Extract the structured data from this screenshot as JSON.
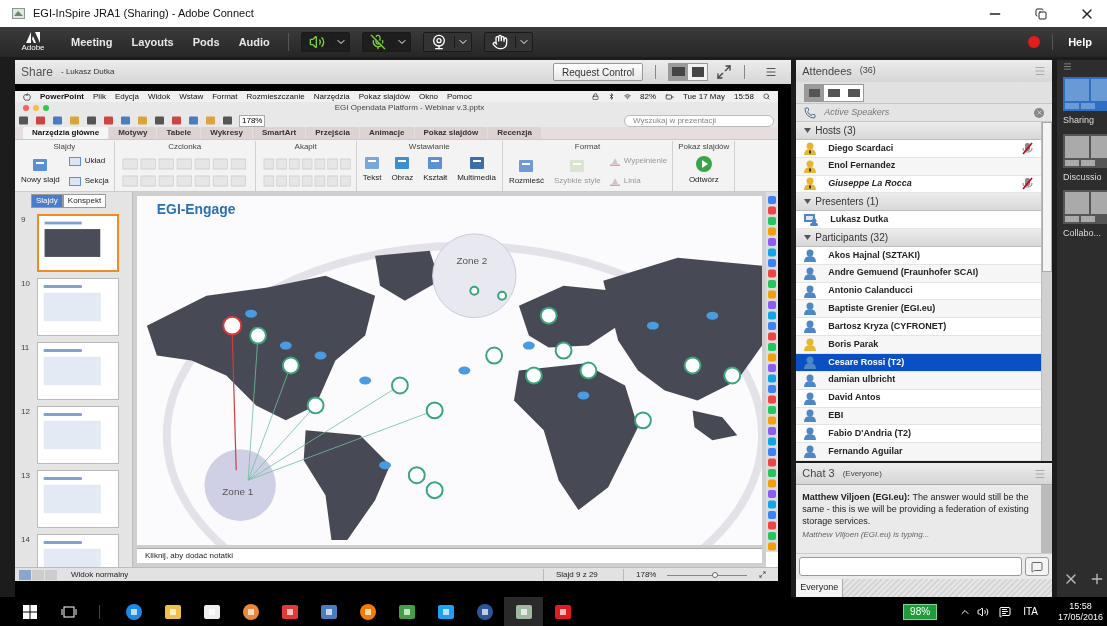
{
  "window": {
    "title": "EGI-InSpire JRA1 (Sharing) - Adobe Connect"
  },
  "menubar": {
    "logo_text": "Adobe",
    "items": [
      "Meeting",
      "Layouts",
      "Pods",
      "Audio"
    ],
    "help": "Help"
  },
  "share_pod": {
    "title": "Share",
    "presenter": "- Lukasz Dutka",
    "request_button": "Request Control"
  },
  "shared_screen": {
    "mac_menu": [
      "PowerPoint",
      "Plik",
      "Edycja",
      "Widok",
      "Wstaw",
      "Format",
      "Rozmieszczanie",
      "Narzędzia",
      "Pokaz slajdów",
      "Okno",
      "Pomoc"
    ],
    "mac_status": {
      "battery": "82%",
      "date": "Tue 17 May",
      "time": "15:58"
    },
    "doc_title": "EGI Opendata Platform - Webinar v.3.pptx",
    "zoom": "178%",
    "search_placeholder": "Wyszukaj w prezentacji",
    "tabs": [
      {
        "label": "Narzędzia główne",
        "selected": true
      },
      {
        "label": "Motywy",
        "selected": false
      },
      {
        "label": "Tabele",
        "selected": false
      },
      {
        "label": "Wykresy",
        "selected": false
      },
      {
        "label": "SmartArt",
        "selected": false
      },
      {
        "label": "Przejścia",
        "selected": false
      },
      {
        "label": "Animacje",
        "selected": false
      },
      {
        "label": "Pokaz slajdów",
        "selected": false
      },
      {
        "label": "Recenzja",
        "selected": false
      }
    ],
    "ribbon_groups": [
      {
        "title": "Slajdy",
        "kind": "slides",
        "buttons": [
          {
            "label": "Nowy slajd",
            "disabled": false
          },
          {
            "label": "Układ",
            "disabled": false
          },
          {
            "label": "Sekcja",
            "disabled": false
          }
        ]
      },
      {
        "title": "Czcionka",
        "kind": "font"
      },
      {
        "title": "Akapit",
        "kind": "paragraph"
      },
      {
        "title": "Wstawianie",
        "kind": "insert",
        "buttons": [
          {
            "label": "Tekst",
            "disabled": false
          },
          {
            "label": "Obraz",
            "disabled": false
          },
          {
            "label": "Kształt",
            "disabled": false
          },
          {
            "label": "Multimedia",
            "disabled": false
          }
        ]
      },
      {
        "title": "Format",
        "kind": "format",
        "buttons": [
          {
            "label": "Rozmieść",
            "disabled": false
          },
          {
            "label": "Szybkie style",
            "disabled": true
          },
          {
            "label": "Wypełnienie",
            "disabled": true
          },
          {
            "label": "Linia",
            "disabled": true
          }
        ]
      },
      {
        "title": "Pokaz slajdów",
        "kind": "show",
        "buttons": [
          {
            "label": "Odtwórz",
            "disabled": false
          }
        ]
      }
    ],
    "panel_tabs": [
      {
        "label": "Slajdy",
        "selected": true
      },
      {
        "label": "Konspekt",
        "selected": false
      }
    ],
    "thumbnails": [
      {
        "number": "9",
        "selected": true
      },
      {
        "number": "10",
        "selected": false
      },
      {
        "number": "11",
        "selected": false
      },
      {
        "number": "12",
        "selected": false
      },
      {
        "number": "13",
        "selected": false
      },
      {
        "number": "14",
        "selected": false
      }
    ],
    "slide": {
      "title": "EGI-Engage",
      "zones": [
        "Zone 1",
        "Zone 2"
      ]
    },
    "notes_placeholder": "Kliknij, aby dodać notatki",
    "status": {
      "view": "Widok normalny",
      "slide": "Slajd 9 z 29",
      "zoom": "178%",
      "zoom_slider": {
        "level": 0.6
      }
    }
  },
  "attendees": {
    "title": "Attendees",
    "count": "(36)",
    "active_speakers": "Active Speakers",
    "groups": [
      {
        "label": "Hosts (3)",
        "expanded": true,
        "people": [
          {
            "name": "Diego Scardaci",
            "kind": "host",
            "color": "#e8b530",
            "mic_muted": true,
            "connecting": false,
            "selected": false
          },
          {
            "name": "Enol Fernandez",
            "kind": "host",
            "color": "#e8b530",
            "mic_muted": false,
            "connecting": false,
            "selected": false
          },
          {
            "name": "Giuseppe La Rocca",
            "kind": "host",
            "color": "#e8b530",
            "mic_muted": true,
            "connecting": true,
            "selected": false
          }
        ]
      },
      {
        "label": "Presenters (1)",
        "expanded": true,
        "people": [
          {
            "name": "Lukasz Dutka",
            "kind": "presenter",
            "color": "#4f86c6",
            "mic_muted": false,
            "connecting": false,
            "selected": false
          }
        ]
      },
      {
        "label": "Participants (32)",
        "expanded": true,
        "people": [
          {
            "name": "Akos Hajnal (SZTAKI)",
            "kind": "participant",
            "color": "#4f86c6",
            "mic_muted": false,
            "connecting": false,
            "selected": false
          },
          {
            "name": "Andre Gemuend (Fraunhofer SCAI)",
            "kind": "participant",
            "color": "#4f86c6",
            "mic_muted": false,
            "connecting": false,
            "selected": false
          },
          {
            "name": "Antonio Calanducci",
            "kind": "participant",
            "color": "#4f86c6",
            "mic_muted": false,
            "connecting": false,
            "selected": false
          },
          {
            "name": "Baptiste Grenier (EGI.eu)",
            "kind": "participant",
            "color": "#4f86c6",
            "mic_muted": false,
            "connecting": false,
            "selected": false
          },
          {
            "name": "Bartosz Kryza (CYFRONET)",
            "kind": "participant",
            "color": "#4f86c6",
            "mic_muted": false,
            "connecting": false,
            "selected": false
          },
          {
            "name": "Boris Parak",
            "kind": "participant",
            "color": "#e8b530",
            "mic_muted": false,
            "connecting": false,
            "selected": false
          },
          {
            "name": "Cesare Rossi (T2)",
            "kind": "participant",
            "color": "#4f86c6",
            "mic_muted": false,
            "connecting": false,
            "selected": true
          },
          {
            "name": "damian ulbricht",
            "kind": "participant",
            "color": "#4f86c6",
            "mic_muted": false,
            "connecting": false,
            "selected": false
          },
          {
            "name": "David Antos",
            "kind": "participant",
            "color": "#4f86c6",
            "mic_muted": false,
            "connecting": false,
            "selected": false
          },
          {
            "name": "EBI",
            "kind": "participant",
            "color": "#4f86c6",
            "mic_muted": false,
            "connecting": false,
            "selected": false
          },
          {
            "name": "Fabio D'Andria (T2)",
            "kind": "participant",
            "color": "#4f86c6",
            "mic_muted": false,
            "connecting": false,
            "selected": false
          },
          {
            "name": "Fernando Aguilar",
            "kind": "participant",
            "color": "#4f86c6",
            "mic_muted": false,
            "connecting": false,
            "selected": false
          }
        ]
      }
    ]
  },
  "chat": {
    "title": "Chat 3",
    "audience": "(Everyone)",
    "messages": [
      {
        "sender": "Matthew Viljoen (EGI.eu):",
        "text": "The answer would still be the same - this is we will be providing a federation of existing storage services."
      }
    ],
    "typing": "Matthew Viljoen (EGI.eu) is typing...",
    "tabs": [
      "Everyone"
    ]
  },
  "layouts": [
    {
      "label": "Sharing",
      "selected": true
    },
    {
      "label": "Discussio",
      "selected": false
    },
    {
      "label": "Collabo...",
      "selected": false
    }
  ],
  "taskbar": {
    "battery": "98%",
    "language": "ITA",
    "time": "15:58",
    "date": "17/05/2016"
  }
}
